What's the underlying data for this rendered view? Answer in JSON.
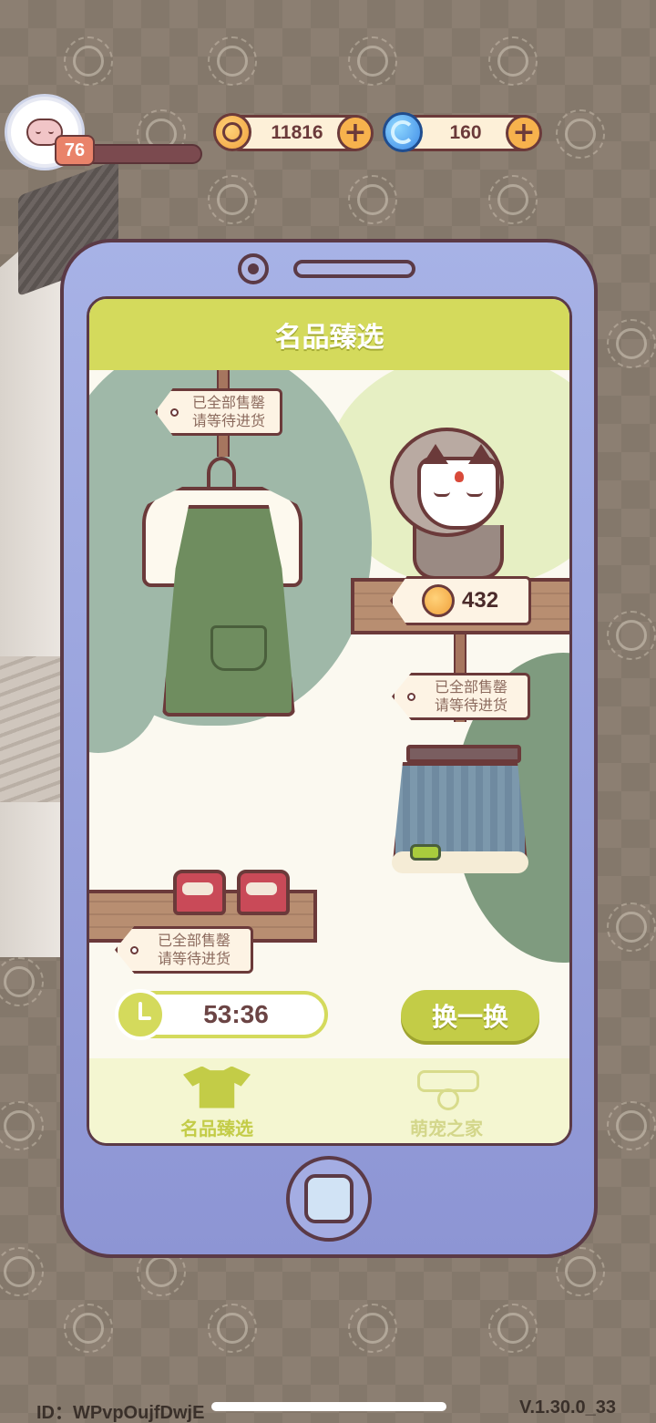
{
  "hud": {
    "level": "76",
    "level_progress": 0.1,
    "coins": "11816",
    "gems": "160",
    "coin_icon": "coin-icon",
    "gem_icon": "gem-icon",
    "plus_symbol": "+"
  },
  "shop": {
    "title": "名品臻选",
    "sold_out_line1": "已全部售罄",
    "sold_out_line2": "请等待进货",
    "items": [
      {
        "name": "apron-outfit",
        "status": "sold_out"
      },
      {
        "name": "fox-mask",
        "price": "432",
        "status": "available"
      },
      {
        "name": "denim-skirt",
        "status": "sold_out"
      },
      {
        "name": "red-sneakers",
        "status": "sold_out"
      }
    ],
    "timer": "53:36",
    "refresh_label": "换一换"
  },
  "nav": {
    "tabs": [
      {
        "label": "名品臻选",
        "icon": "tshirt-icon",
        "active": true
      },
      {
        "label": "萌宠之家",
        "icon": "collar-icon",
        "active": false
      }
    ]
  },
  "footer": {
    "id_text": "ID：WPvpOujfDwjE",
    "version": "V.1.30.0_33"
  },
  "colors": {
    "accent": "#d4da5c",
    "phone_body": "#8d95d4",
    "outline": "#6b3a3a"
  }
}
